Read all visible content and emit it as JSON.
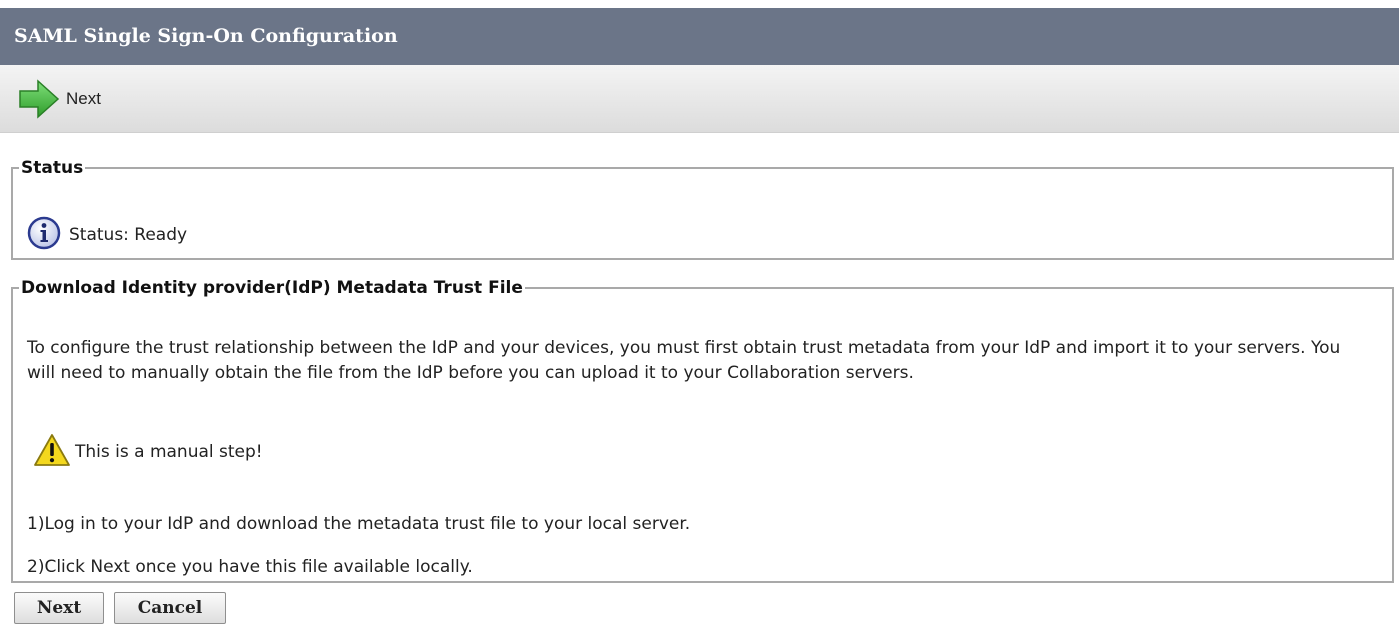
{
  "window": {
    "title": "SAML Single Sign-On Configuration"
  },
  "toolbar": {
    "next_label": "Next",
    "next_icon": "arrow-right-icon"
  },
  "status": {
    "legend": "Status",
    "text": "Status: Ready",
    "icon": "info-icon"
  },
  "download": {
    "legend": "Download Identity provider(IdP) Metadata Trust File",
    "description": "To configure the trust relationship between the IdP and your devices, you must first obtain trust metadata from your IdP and import it to your servers. You will need to manually obtain the file from the IdP before you can upload it to your Collaboration servers.",
    "warning": "This is a manual step!",
    "warning_icon": "warning-icon",
    "steps": [
      "1)Log in to your IdP and download the metadata trust file to your local server.",
      "2)Click Next once you have this file available locally."
    ]
  },
  "buttons": {
    "next": "Next",
    "cancel": "Cancel"
  },
  "colors": {
    "titlebar": "#6b7588",
    "arrow_green": "#3fb53a",
    "info_blue": "#2b3a8f",
    "warning_yellow": "#f4d81e"
  }
}
